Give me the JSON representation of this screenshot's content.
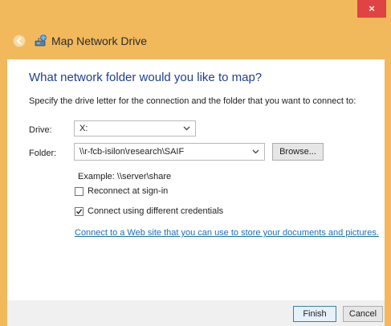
{
  "window": {
    "title": "Map Network Drive",
    "close_glyph": "×"
  },
  "content": {
    "heading": "What network folder would you like to map?",
    "instructions": "Specify the drive letter for the connection and the folder that you want to connect to:",
    "drive": {
      "label": "Drive:",
      "value": "X:"
    },
    "folder": {
      "label": "Folder:",
      "value": "\\\\r-fcb-isilon\\research\\SAIF"
    },
    "browse_label": "Browse...",
    "example": "Example: \\\\server\\share",
    "reconnect": {
      "label": "Reconnect at sign-in",
      "checked": false
    },
    "credentials": {
      "label": "Connect using different credentials",
      "checked": true
    },
    "link": "Connect to a Web site that you can use to store your documents and pictures."
  },
  "footer": {
    "finish_label": "Finish",
    "cancel_label": "Cancel"
  },
  "icons": {
    "back": "back-arrow-icon",
    "drive": "network-drive-icon",
    "close": "close-icon",
    "chevron": "chevron-down-icon",
    "check": "checkmark-icon"
  },
  "colors": {
    "frame": "#f1b95c",
    "close": "#e04343",
    "heading": "#1f3f8f",
    "link": "#1a6fbf"
  }
}
